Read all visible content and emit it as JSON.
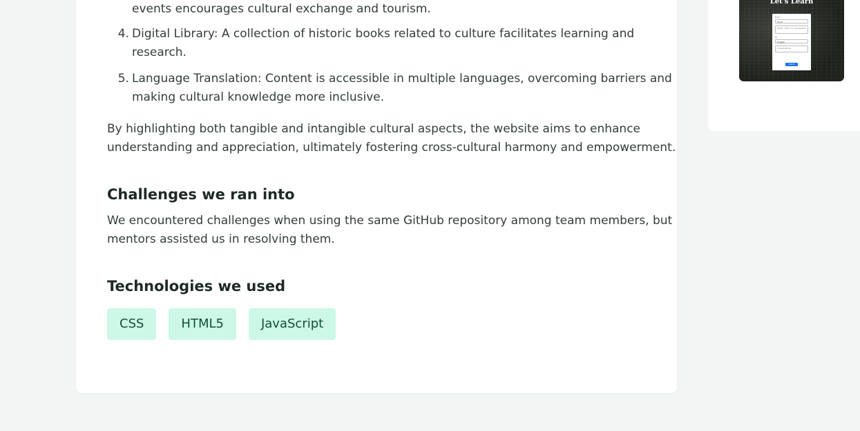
{
  "feature_list": {
    "item3_tail": "events encourages cultural exchange and tourism.",
    "items": [
      {
        "number": "4.",
        "line1": "Digital Library: A collection of historic books related to culture facilitates learning and",
        "line2": "research."
      },
      {
        "number": "5.",
        "line1": "Language Translation: Content is accessible in multiple languages, overcoming barriers and",
        "line2": "making cultural knowledge more inclusive."
      }
    ]
  },
  "summary_paragraph": {
    "line1": "By highlighting both tangible and intangible cultural aspects, the website aims to enhance",
    "line2": "understanding and appreciation, ultimately fostering cross-cultural harmony and empowerment."
  },
  "challenges": {
    "heading": "Challenges we ran into",
    "line1": "We encountered challenges when using the same GitHub repository among team members, but",
    "line2": "mentors assisted us in resolving them."
  },
  "technologies": {
    "heading": "Technologies we used",
    "tags": [
      "CSS",
      "HTML5",
      "JavaScript"
    ]
  },
  "gallery_thumbnail": {
    "title": "Let's Learn",
    "form": {
      "from_label": "From",
      "from_value": "Hindi",
      "input_placeholder": "Enter text to translate",
      "to_label": "To",
      "to_value": "English",
      "output_placeholder": "Translation",
      "button_label": "Submit"
    }
  },
  "colors": {
    "page_background": "#f3f5f4",
    "card_background": "#ffffff",
    "tag_background": "#cdf7e6",
    "tag_text": "#10503b",
    "thumb_button": "#1a73e8"
  }
}
